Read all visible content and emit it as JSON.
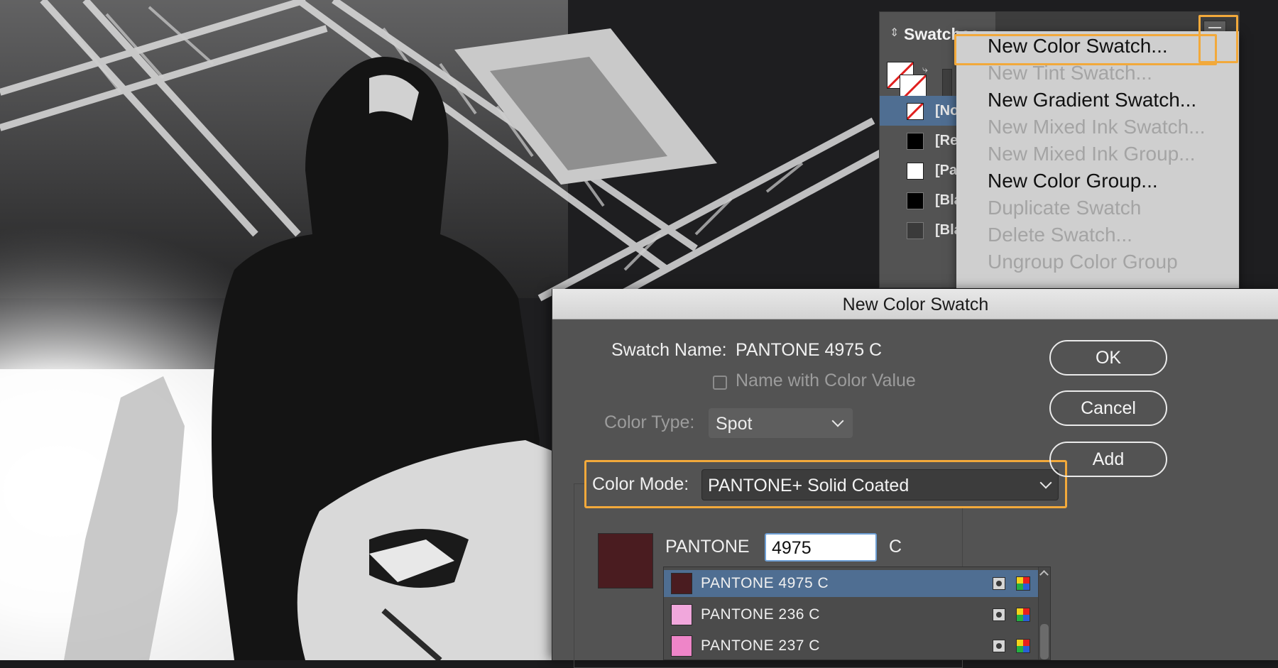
{
  "swatches_panel": {
    "title": "Swatches",
    "rows": [
      {
        "label": "[None]",
        "color": "none"
      },
      {
        "label": "[Registration]",
        "color": "#000000"
      },
      {
        "label": "[Paper]",
        "color": "#ffffff"
      },
      {
        "label": "[Black]",
        "color": "#000000"
      },
      {
        "label": "[Black]",
        "color": "#3a3a3a"
      }
    ]
  },
  "panel_menu": {
    "items": [
      {
        "label": "New Color Swatch...",
        "enabled": true
      },
      {
        "label": "New Tint Swatch...",
        "enabled": false
      },
      {
        "label": "New Gradient Swatch...",
        "enabled": true
      },
      {
        "label": "New Mixed Ink Swatch...",
        "enabled": false
      },
      {
        "label": "New Mixed Ink Group...",
        "enabled": false
      },
      {
        "label": "New Color Group...",
        "enabled": true
      },
      {
        "label": "Duplicate Swatch",
        "enabled": false
      },
      {
        "label": "Delete Swatch...",
        "enabled": false
      },
      {
        "label": "Ungroup Color Group",
        "enabled": false
      }
    ]
  },
  "dialog": {
    "title": "New Color Swatch",
    "swatch_name_label": "Swatch Name:",
    "swatch_name_value": "PANTONE 4975 C",
    "name_with_color_value_label": "Name with Color Value",
    "name_with_color_value_checked": false,
    "color_type_label": "Color Type:",
    "color_type_value": "Spot",
    "color_mode_label": "Color Mode:",
    "color_mode_value": "PANTONE+ Solid Coated",
    "pantone_prefix": "PANTONE",
    "pantone_number": "4975",
    "pantone_suffix": "C",
    "preview_color": "#4a1c20",
    "pantone_list": [
      {
        "name": "PANTONE 4975 C",
        "color": "#4a1c20",
        "selected": true
      },
      {
        "name": "PANTONE 236 C",
        "color": "#f1a7dc",
        "selected": false
      },
      {
        "name": "PANTONE 237 C",
        "color": "#ee85c8",
        "selected": false
      }
    ],
    "buttons": {
      "ok": "OK",
      "cancel": "Cancel",
      "add": "Add"
    }
  },
  "colors": {
    "highlight": "#f2a93b",
    "selection": "#4f6e92"
  }
}
